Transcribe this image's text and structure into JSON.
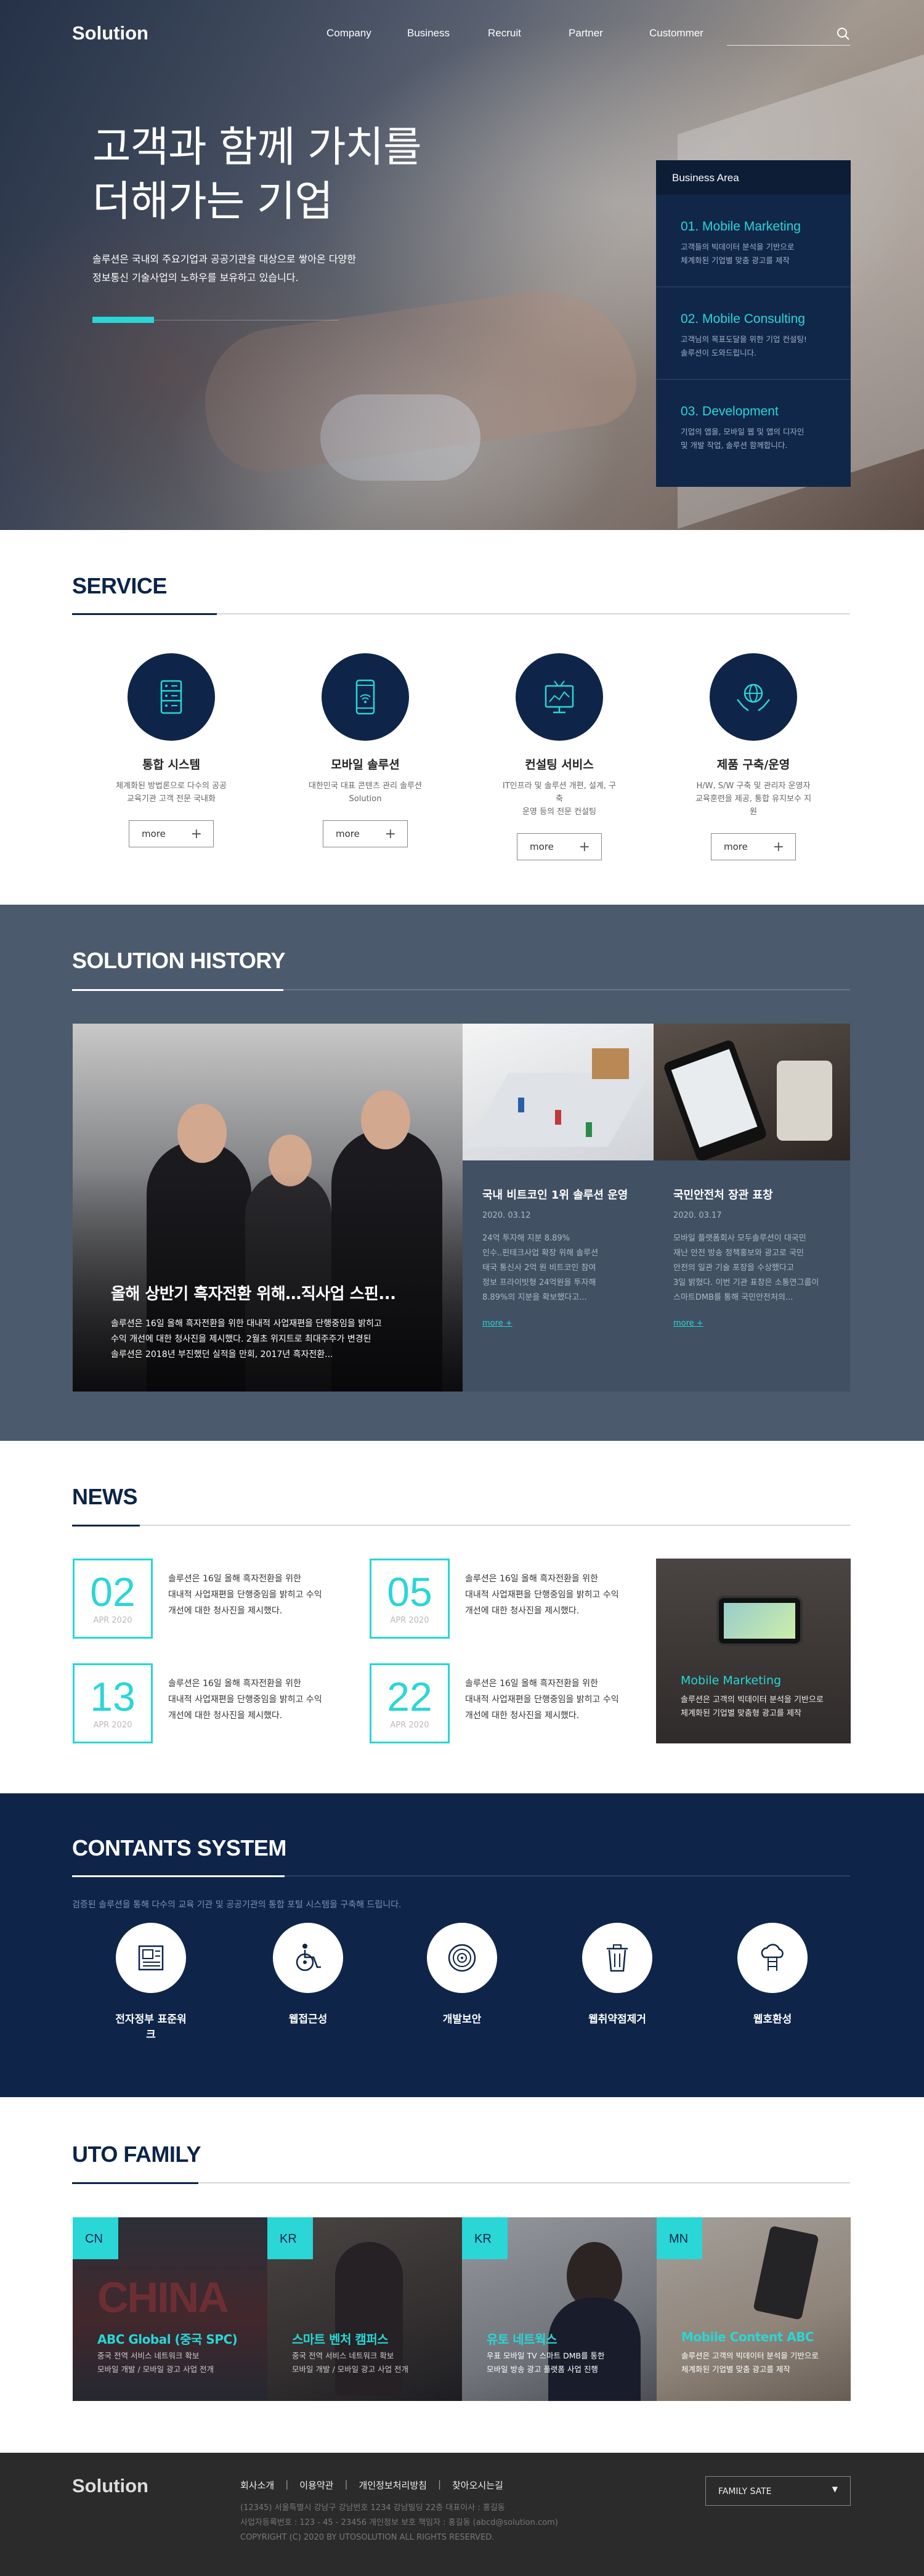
{
  "header": {
    "logo": "Solution",
    "nav": [
      "Company",
      "Business",
      "Recruit",
      "Partner",
      "Custommer"
    ]
  },
  "hero": {
    "title_line1": "고객과 함께 가치를",
    "title_line2": "더해가는 기업",
    "desc_line1": "솔루션은 국내외 주요기업과 공공기관을 대상으로 쌓아온 다양한",
    "desc_line2": "정보통신 기술사업의 노하우를 보유하고 있습니다.",
    "accent": "#2ad6d6"
  },
  "business": {
    "title": "Business Area",
    "items": [
      {
        "title": "01. Mobile Marketing",
        "desc1": "고객들의 빅데이터 분석을 기반으로",
        "desc2": "체계화된 기업별 맞춤 광고를 제작"
      },
      {
        "title": "02. Mobile Consulting",
        "desc1": "고객님의 목표도달을 위한 기업 컨설팅!",
        "desc2": "솔루션이 도와드립니다."
      },
      {
        "title": "03. Development",
        "desc1": "기업의 앱을, 모바일 웹 및 앱의 디자인",
        "desc2": "및 개발 작업, 솔루션 함께합니다."
      }
    ]
  },
  "service": {
    "title": "SERVICE",
    "items": [
      {
        "name": "통합 시스템",
        "desc1": "체계화된 방법론으로 다수의 공공",
        "desc2": "교육기관 고객 전문 국내화",
        "more": "more",
        "icon": "server-icon"
      },
      {
        "name": "모바일 솔루션",
        "desc1": "대한민국 대표 콘텐츠 관리 솔루션",
        "desc2": "Solution",
        "more": "more",
        "icon": "mobile-icon"
      },
      {
        "name": "컨설팅 서비스",
        "desc1": "IT인프라 및 솔루션 개편, 설계, 구축",
        "desc2": "운영 등의 전문 컨설팅",
        "more": "more",
        "icon": "monitor-icon"
      },
      {
        "name": "제품 구축/운영",
        "desc1": "H/W, S/W 구축 및 관리자 운영자",
        "desc2": "교육훈련을 제공, 통합 유지보수 지원",
        "more": "more",
        "icon": "globe-hands-icon"
      }
    ]
  },
  "history": {
    "title": "SOLUTION HISTORY",
    "main": {
      "title": "올해 상반기 흑자전환 위해…직사업 스핀...",
      "desc1": "솔루션은 16일 올해 흑자전환을 위한 대내적 사업재편을 단행중임을 밝히고",
      "desc2": "수익 개선에 대한 청사진을 제시했다. 2월초 위지트로 최대주주가 변경된",
      "desc3": "솔루션은 2018년 부진했던 실적을 만회, 2017년 흑자전환..."
    },
    "cards": [
      {
        "title": "국내 비트코인 1위 솔루션 운영",
        "date": "2020. 03.12",
        "desc1": "24억 투자해 지분 8.89%",
        "desc2": "인수..핀테크사업 확장 위해 솔루션",
        "desc3": "태국 통신사 2억 원 비트코인 참여",
        "desc4": "정보 프라이빗형 24억원을 투자해",
        "desc5": "8.89%의 지분을 확보했다고...",
        "more": "more +"
      },
      {
        "title": "국민안전처 장관 표창",
        "date": "2020. 03.17",
        "desc1": "모바일 플랫폼회사 모두솔루션이 대국민",
        "desc2": "재난 안전 방송 정책홍보와 광고로 국민",
        "desc3": "안전의 일관 기술 포장을 수상했다고",
        "desc4": "3일 밝혔다. 이번 기관 표창은 소통연그룹이",
        "desc5": "스마트DMB를 통해 국민안전처의...",
        "more": "more +"
      }
    ]
  },
  "news": {
    "title": "NEWS",
    "items": [
      {
        "day": "02",
        "month": "APR 2020",
        "text1": "솔루션은 16일 올해 흑자전환을 위한",
        "text2": "대내적 사업재편을 단행중임을 밝히고 수익",
        "text3": "개선에 대한 청사진을 제시했다."
      },
      {
        "day": "05",
        "month": "APR 2020",
        "text1": "솔루션은 16일 올해 흑자전환을 위한",
        "text2": "대내적 사업재편을 단행중임을 밝히고 수익",
        "text3": "개선에 대한 청사진을 제시했다."
      },
      {
        "day": "13",
        "month": "APR 2020",
        "text1": "솔루션은 16일 올해 흑자전환을 위한",
        "text2": "대내적 사업재편을 단행중임을 밝히고 수익",
        "text3": "개선에 대한 청사진을 제시했다."
      },
      {
        "day": "22",
        "month": "APR 2020",
        "text1": "솔루션은 16일 올해 흑자전환을 위한",
        "text2": "대내적 사업재편을 단행중임을 밝히고 수익",
        "text3": "개선에 대한 청사진을 제시했다."
      }
    ],
    "feature": {
      "title": "Mobile Marketing",
      "desc1": "솔루션은 고객의 빅데이터 분석을 기반으로",
      "desc2": "체계화된 기업별 맞춤형 광고를 제작"
    }
  },
  "contents": {
    "title": "CONTANTS SYSTEM",
    "subtitle": "검증된 솔루션을 통해 다수의 교육 기관 및 공공기관의 통합 포털 시스템을 구축해 드립니다.",
    "items": [
      {
        "label": "전자정부 표준워크",
        "icon": "document-icon"
      },
      {
        "label": "웹접근성",
        "icon": "wheelchair-icon"
      },
      {
        "label": "개발보안",
        "icon": "security-target-icon"
      },
      {
        "label": "웹취약점제거",
        "icon": "trash-icon"
      },
      {
        "label": "웹호환성",
        "icon": "cloud-network-icon"
      }
    ]
  },
  "family": {
    "title": "UTO FAMILY",
    "items": [
      {
        "tag": "CN",
        "title": "ABC Global (중국 SPC)",
        "desc1": "중국 전역 서비스 네트워크 확보",
        "desc2": "모바일 개발 / 모바일 광고 사업 전개"
      },
      {
        "tag": "KR",
        "title": "스마트 벤처 캠퍼스",
        "desc1": "중국 전역 서비스 네트워크 확보",
        "desc2": "모바일 개발 / 모바일 광고 사업 전개"
      },
      {
        "tag": "KR",
        "title": "유토 네트웍스",
        "desc1": "우표 모바일 TV 스마트 DMB를 통한",
        "desc2": "모바일 방송 광고 플랫폼 사업 진행"
      },
      {
        "tag": "MN",
        "title": "Mobile Content ABC",
        "desc1": "솔루션은 고객의 빅데이터 분석을 기반으로",
        "desc2": "체계화된 기업별 맞춤 광고를 제작"
      }
    ]
  },
  "footer": {
    "logo": "Solution",
    "links": [
      "회사소개",
      "이용약관",
      "개인정보처리방침",
      "찾아오시는길"
    ],
    "sep": "|",
    "info1": "(12345) 서울특별시 강남구 강남번호 1234 강남빌딩 22층 대표이사 : 홍길동",
    "info2": "사업자등록번호 : 123 - 45 - 23456 개인정보 보호 책임자 : 홍길동 (abcd@solution.com)",
    "info3": "COPYRIGHT (C) 2020 BY UTOSOLUTION ALL RIGHTS RESERVED.",
    "family_select": "FAMILY SATE"
  }
}
